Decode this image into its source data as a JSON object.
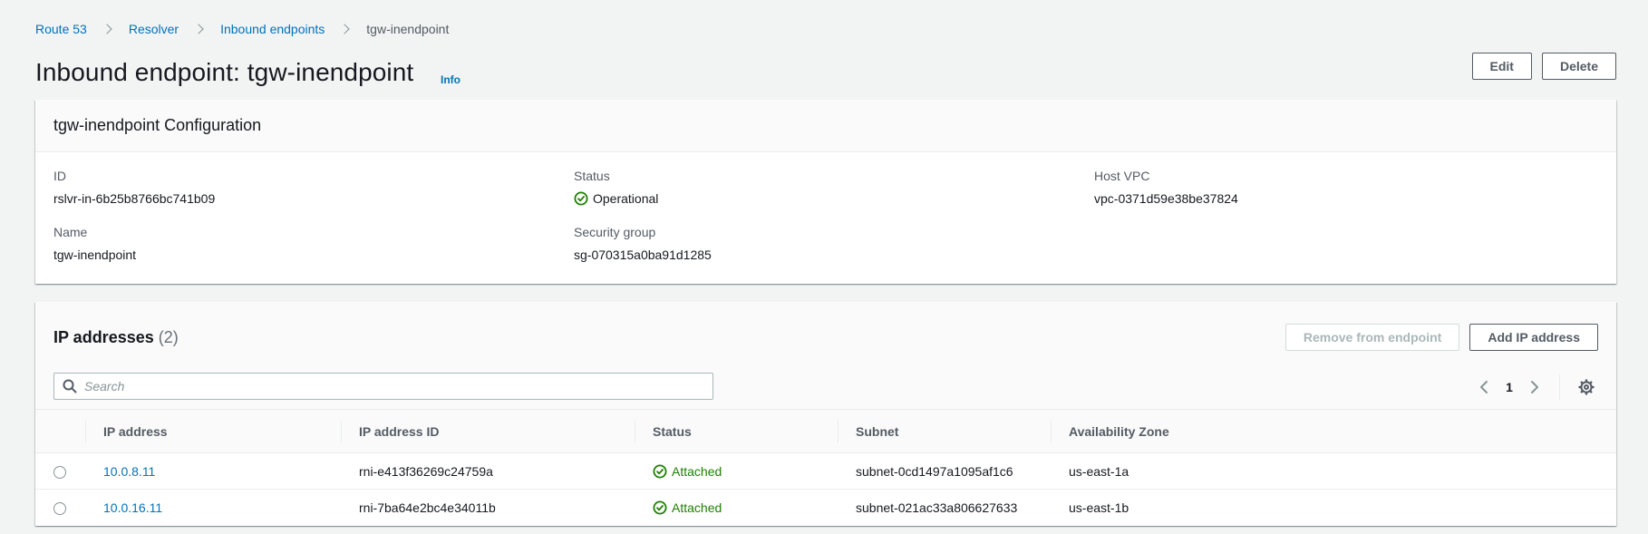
{
  "breadcrumb": {
    "items": [
      "Route 53",
      "Resolver",
      "Inbound endpoints"
    ],
    "current": "tgw-inendpoint"
  },
  "page": {
    "title": "Inbound endpoint: tgw-inendpoint",
    "info": "Info",
    "edit": "Edit",
    "delete": "Delete"
  },
  "config": {
    "title": "tgw-inendpoint Configuration",
    "id_label": "ID",
    "id_value": "rslvr-in-6b25b8766bc741b09",
    "status_label": "Status",
    "status_value": "Operational",
    "vpc_label": "Host VPC",
    "vpc_value": "vpc-0371d59e38be37824",
    "name_label": "Name",
    "name_value": "tgw-inendpoint",
    "sg_label": "Security group",
    "sg_value": "sg-070315a0ba91d1285"
  },
  "ip_table": {
    "title": "IP addresses",
    "count": "(2)",
    "remove_button": "Remove from endpoint",
    "add_button": "Add IP address",
    "search_placeholder": "Search",
    "page": "1",
    "columns": [
      "IP address",
      "IP address ID",
      "Status",
      "Subnet",
      "Availability Zone"
    ],
    "rows": [
      {
        "ip": "10.0.8.11",
        "id": "rni-e413f36269c24759a",
        "status": "Attached",
        "subnet": "subnet-0cd1497a1095af1c6",
        "az": "us-east-1a"
      },
      {
        "ip": "10.0.16.11",
        "id": "rni-7ba64e2bc4e34011b",
        "status": "Attached",
        "subnet": "subnet-021ac33a806627633",
        "az": "us-east-1b"
      }
    ]
  },
  "colors": {
    "link": "#0073bb",
    "success": "#1d8102",
    "background": "#f2f3f3"
  },
  "icons": [
    "chevron-right-icon",
    "check-circle-icon",
    "search-icon",
    "chevron-left-icon",
    "gear-icon"
  ]
}
